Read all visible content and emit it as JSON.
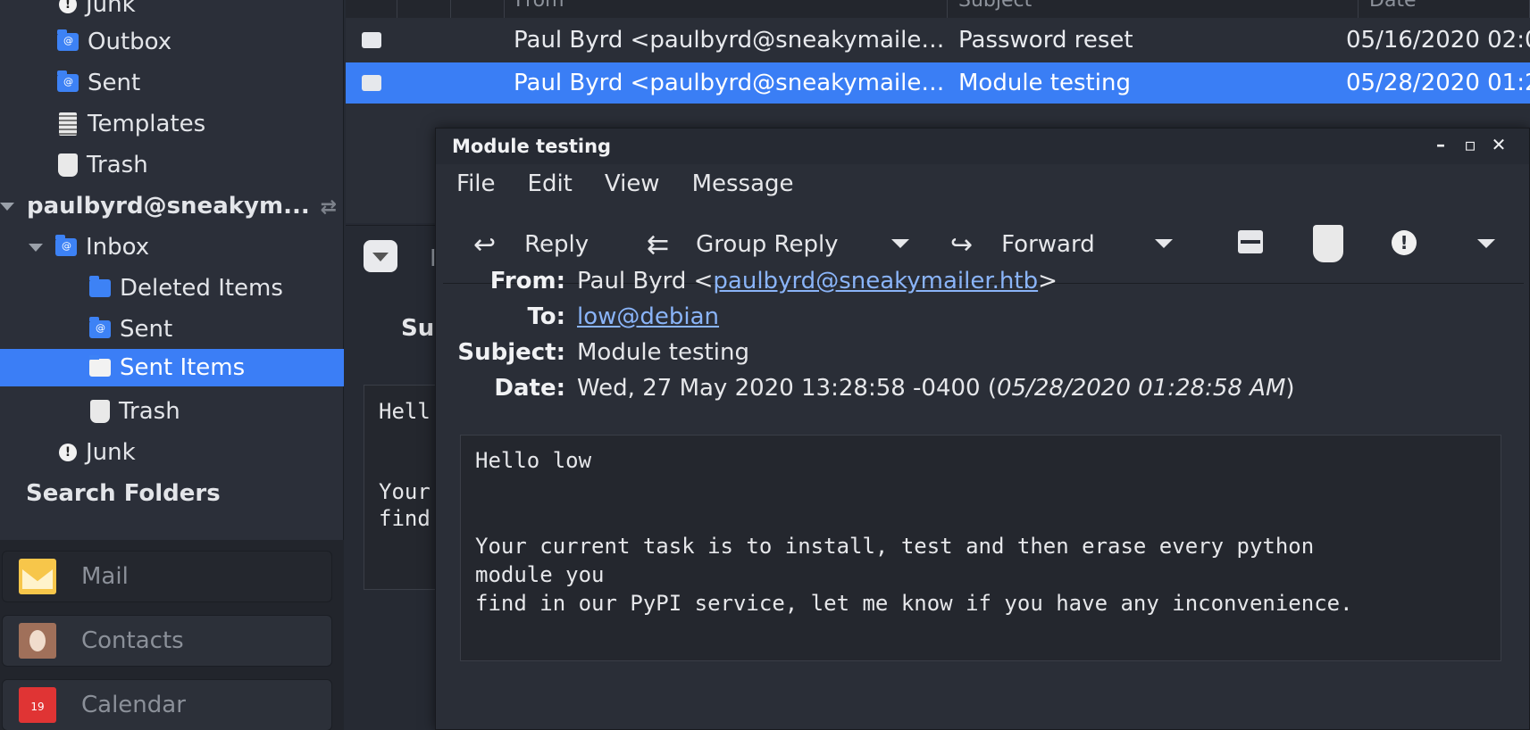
{
  "sidebar": {
    "folders": [
      {
        "label": "Junk",
        "icon": "junk-icon"
      },
      {
        "label": "Outbox",
        "icon": "folder-icon"
      },
      {
        "label": "Sent",
        "icon": "folder-icon"
      },
      {
        "label": "Templates",
        "icon": "templates-icon"
      },
      {
        "label": "Trash",
        "icon": "trash-icon"
      }
    ],
    "account": "paulbyrd@sneakym...",
    "inbox_label": "Inbox",
    "inbox_children": [
      {
        "label": "Deleted Items",
        "icon": "folder-icon"
      },
      {
        "label": "Sent",
        "icon": "folder-icon"
      },
      {
        "label": "Sent Items",
        "icon": "folder-icon",
        "selected": true
      },
      {
        "label": "Trash",
        "icon": "trash-icon"
      }
    ],
    "junk_label": "Junk",
    "search_folders": "Search Folders"
  },
  "apps": [
    {
      "label": "Mail",
      "icon": "mail-icon"
    },
    {
      "label": "Contacts",
      "icon": "contacts-icon"
    },
    {
      "label": "Calendar",
      "icon": "calendar-icon",
      "day": "19"
    }
  ],
  "message_list": {
    "columns": [
      "From",
      "Subject",
      "Date"
    ],
    "rows": [
      {
        "from": "Paul Byrd <paulbyrd@sneakymaile…",
        "subject": "Password reset",
        "date": "05/16/2020 02:0",
        "selected": false
      },
      {
        "from": "Paul Byrd <paulbyrd@sneakymaile…",
        "subject": "Module testing",
        "date": "05/28/2020 01:2",
        "selected": true
      }
    ]
  },
  "preview": {
    "subject_fragment": "Su",
    "label_fragment": "I",
    "body_fragment": "Hell\n\n\nYour\nfind"
  },
  "message_window": {
    "title": "Module testing",
    "controls": {
      "minimize": "–",
      "maximize": "▫",
      "close": "✕"
    },
    "menu": [
      "File",
      "Edit",
      "View",
      "Message"
    ],
    "toolbar": {
      "reply": "Reply",
      "group_reply": "Group Reply",
      "forward": "Forward"
    },
    "headers": {
      "from_label": "From:",
      "from_name": "Paul Byrd <",
      "from_email": "paulbyrd@sneakymailer.htb",
      "from_tail": ">",
      "to_label": "To:",
      "to_email": "low@debian",
      "subject_label": "Subject:",
      "subject": "Module testing",
      "date_label": "Date:",
      "date": "Wed, 27 May 2020 13:28:58 -0400 (",
      "date_local": "05/28/2020 01:28:58 AM",
      "date_tail": ")"
    },
    "body": "Hello low\n\n\nYour current task is to install, test and then erase every python\nmodule you\nfind in our PyPI service, let me know if you have any inconvenience."
  },
  "colors": {
    "accent": "#3b7ef6",
    "background": "#262a33",
    "link": "#8ab4f8"
  }
}
